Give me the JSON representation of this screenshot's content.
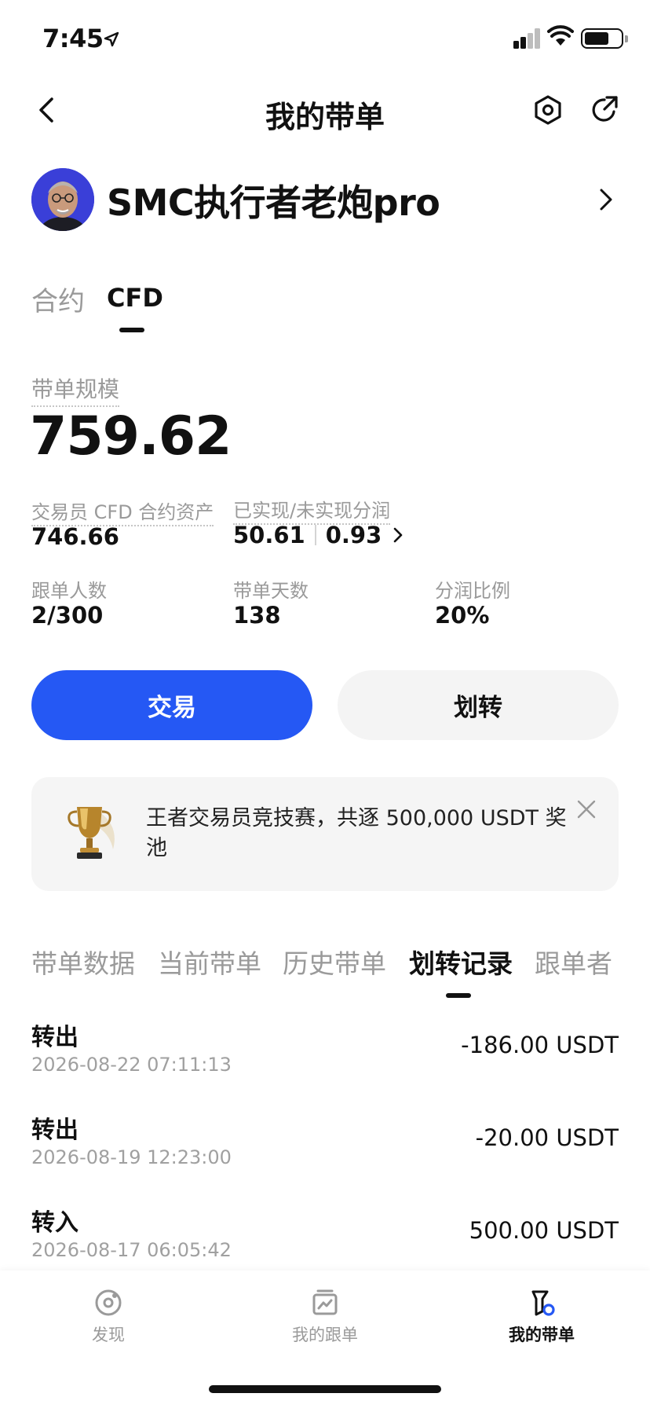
{
  "status_bar": {
    "time": "7:45"
  },
  "nav": {
    "title": "我的带单"
  },
  "profile": {
    "name": "SMC执行者老炮pro"
  },
  "type_tabs": [
    {
      "label": "合约",
      "active": false
    },
    {
      "label": "CFD",
      "active": true
    }
  ],
  "scale": {
    "label": "带单规模",
    "value": "759.62"
  },
  "stats": {
    "cfd_assets_label": "交易员 CFD 合约资产",
    "cfd_assets_value": "746.66",
    "pnl_label": "已实现/未实现分润",
    "realized": "50.61",
    "unrealized": "0.93",
    "followers_label": "跟单人数",
    "followers_value": "2/300",
    "days_label": "带单天数",
    "days_value": "138",
    "share_label": "分润比例",
    "share_value": "20%"
  },
  "actions": {
    "trade": "交易",
    "transfer": "划转"
  },
  "banner": {
    "text": "王者交易员竞技赛，共逐 500,000 USDT 奖池"
  },
  "section_tabs": [
    {
      "label": "带单数据",
      "active": false
    },
    {
      "label": "当前带单",
      "active": false
    },
    {
      "label": "历史带单",
      "active": false
    },
    {
      "label": "划转记录",
      "active": true
    },
    {
      "label": "跟单者",
      "active": false
    }
  ],
  "transfers": [
    {
      "type": "转出",
      "time": "2026-08-22 07:11:13",
      "amount": "-186.00 USDT"
    },
    {
      "type": "转出",
      "time": "2026-08-19 12:23:00",
      "amount": "-20.00 USDT"
    },
    {
      "type": "转入",
      "time": "2026-08-17 06:05:42",
      "amount": "500.00 USDT"
    }
  ],
  "bottom_tabs": [
    {
      "label": "发现",
      "icon": "discover-icon",
      "active": false
    },
    {
      "label": "我的跟单",
      "icon": "copy-trades-icon",
      "active": false
    },
    {
      "label": "我的带单",
      "icon": "lead-trades-icon",
      "active": true
    }
  ],
  "colors": {
    "accent": "#2558f4",
    "muted": "#9a9a9a"
  }
}
